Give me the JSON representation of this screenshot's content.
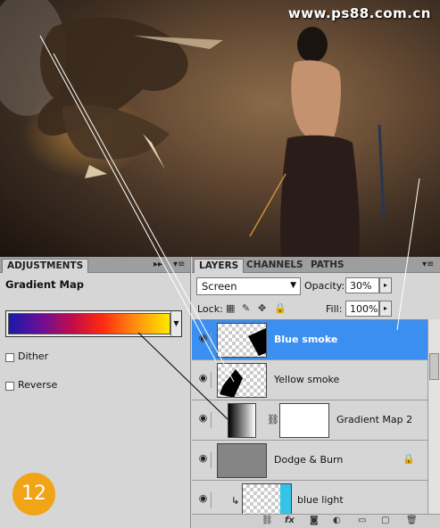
{
  "watermark": "www.ps88.com.cn",
  "colors": {
    "selected_row": "#3b8ff0",
    "badge": "#f0a416",
    "panel_bg": "#d6d6d6"
  },
  "adjustments": {
    "tab_label": "ADJUSTMENTS",
    "tab_controls": "▸▸",
    "menu_icon": "▾≡",
    "title": "Gradient Map",
    "dither_label": "Dither",
    "reverse_label": "Reverse",
    "dither_checked": false,
    "reverse_checked": false,
    "step_badge": "12"
  },
  "layers_panel": {
    "tabs": [
      {
        "label": "LAYERS",
        "active": true
      },
      {
        "label": "CHANNELS",
        "active": false
      },
      {
        "label": "PATHS",
        "active": false
      }
    ],
    "blend_mode": "Screen",
    "opacity_label": "Opacity:",
    "opacity_value": "30%",
    "lock_label": "Lock:",
    "fill_label": "Fill:",
    "fill_value": "100%",
    "layers": [
      {
        "name": "Blue smoke",
        "selected": true,
        "icon": "eye-icon"
      },
      {
        "name": "Yellow smoke",
        "selected": false,
        "icon": "eye-icon"
      },
      {
        "name": "Gradient Map 2",
        "selected": false,
        "icon": "eye-icon",
        "type": "adjustment"
      },
      {
        "name": "Dodge & Burn",
        "selected": false,
        "icon": "eye-icon"
      },
      {
        "name": "blue light",
        "selected": false,
        "icon": "eye-icon",
        "clipped": true
      }
    ],
    "footer_icons": [
      "link-icon",
      "fx-icon",
      "mask-icon",
      "adjustment-icon",
      "group-icon",
      "new-layer-icon",
      "trash-icon"
    ]
  }
}
